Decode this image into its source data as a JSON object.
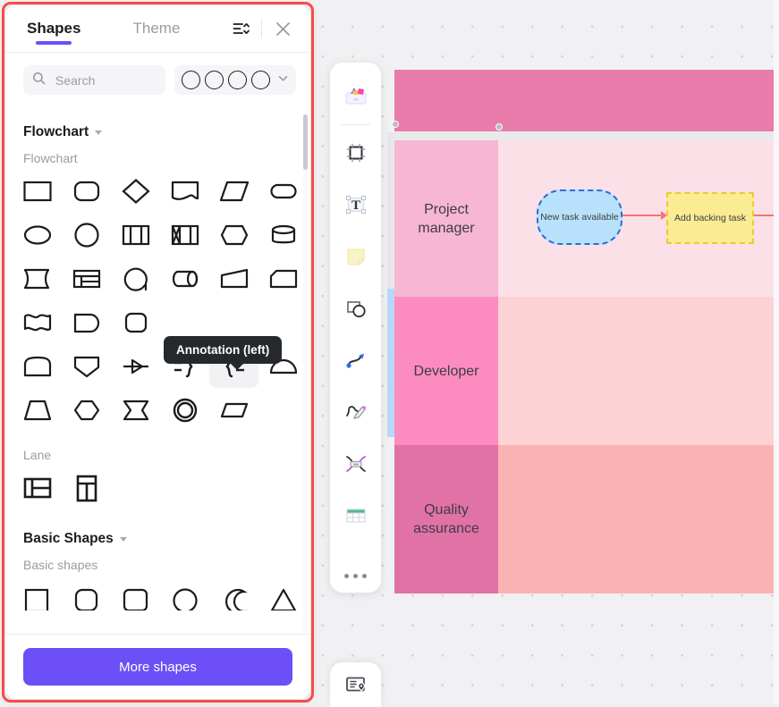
{
  "panel": {
    "tabs": [
      {
        "label": "Shapes",
        "active": true
      },
      {
        "label": "Theme",
        "active": false
      }
    ],
    "header_icons": [
      {
        "name": "sort-list-icon",
        "glyph": "sort"
      },
      {
        "name": "close-icon",
        "glyph": "close"
      }
    ],
    "search": {
      "placeholder": "Search",
      "value": "",
      "icon": "search-icon"
    },
    "style_circles": {
      "count": 4,
      "dropdown_icon": "chevron-down-icon"
    },
    "groups": [
      {
        "title": "Flowchart",
        "subtitle": "Flowchart",
        "rows": [
          [
            "process",
            "rounded-process",
            "decision",
            "document",
            "data",
            "terminator"
          ],
          [
            "ellipse",
            "circle",
            "predefined-process",
            "internal-storage",
            "hexagon-preparation",
            "database"
          ],
          [
            "stored-data",
            "display-window",
            "manual-operation",
            "direct-access-storage",
            "manual-input",
            "card"
          ],
          [
            "paper-tape",
            "delay",
            "loop-limit",
            "annotation-left-ghost",
            "annotation-hidden",
            "annotation-hidden2"
          ],
          [
            "off-page-connector",
            "shield",
            "arrow-junction",
            "annotation-right",
            "annotation-left",
            "semicircle"
          ],
          [
            "trapezoid",
            "hexagon",
            "merge-arrow",
            "double-circle",
            "parallelogram"
          ]
        ]
      },
      {
        "title": "Lane",
        "subtitle": "Lane",
        "rows": [
          [
            "horizontal-lane",
            "vertical-lane"
          ]
        ]
      },
      {
        "title": "Basic Shapes",
        "subtitle": "Basic shapes",
        "rows": [
          [
            "square",
            "rounded-square",
            "rounded-rect",
            "circle",
            "crescent",
            "triangle"
          ]
        ]
      }
    ],
    "tooltip": {
      "text": "Annotation (left)"
    },
    "footer": {
      "more_shapes_label": "More shapes"
    }
  },
  "toolbar": {
    "items": [
      {
        "name": "shapes-library-icon",
        "label": "Shapes library"
      },
      {
        "name": "frame-icon",
        "label": "Frame"
      },
      {
        "name": "text-icon",
        "label": "Text"
      },
      {
        "name": "sticky-note-icon",
        "label": "Sticky note"
      },
      {
        "name": "shape-tool-icon",
        "label": "Shape"
      },
      {
        "name": "connector-icon",
        "label": "Connector"
      },
      {
        "name": "pen-icon",
        "label": "Pen"
      },
      {
        "name": "mindmap-icon",
        "label": "Mind map"
      },
      {
        "name": "table-icon",
        "label": "Table"
      },
      {
        "name": "more-tools-icon",
        "label": "More"
      }
    ],
    "minimap": {
      "name": "minimap-icon",
      "label": "Minimap"
    }
  },
  "canvas": {
    "lanes": [
      {
        "title": "",
        "header": true,
        "color": "#e87cab"
      },
      {
        "title": "Project manager",
        "color": "#f7b6d2",
        "body_color": "#fce0e8"
      },
      {
        "title": "Developer",
        "color": "#fc8cc0",
        "body_color": "#fdd2d4"
      },
      {
        "title": "Quality assurance",
        "color": "#e172a6",
        "body_color": "#f9b3b3"
      }
    ],
    "nodes": [
      {
        "name": "new-task-available-node",
        "text": "New task available",
        "fill": "#b8e2fb",
        "stroke": "#2a6fd6"
      },
      {
        "name": "add-backing-task-node",
        "text": "Add backing task",
        "fill": "#fbeb92",
        "stroke": "#e8c93f"
      }
    ],
    "connector_color": "#f4766e"
  },
  "colors": {
    "accent": "#6c4ff6",
    "selection_outline": "#fb4a49",
    "tooltip_bg": "#26292c"
  }
}
